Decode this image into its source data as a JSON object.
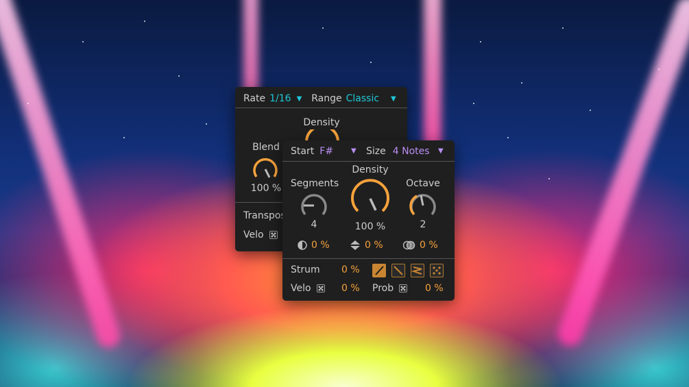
{
  "back_panel": {
    "rate_label": "Rate",
    "rate_value": "1/16",
    "range_label": "Range",
    "range_value": "Classic",
    "density_label": "Density",
    "blend_label": "Blend",
    "blend_value": "100 %",
    "blend_level": 1.0,
    "transpose_label": "Transpos",
    "velo_label": "Velo"
  },
  "front_panel": {
    "start_label": "Start",
    "start_value": "F#",
    "size_label": "Size",
    "size_value": "4 Notes",
    "segments_label": "Segments",
    "segments_value": "4",
    "density_label": "Density",
    "density_value": "100 %",
    "density_level": 1.0,
    "octave_label": "Octave",
    "octave_value": "2",
    "mod1_value": "0 %",
    "mod2_value": "0 %",
    "mod3_value": "0 %",
    "strum_label": "Strum",
    "strum_value": "0 %",
    "velo_label": "Velo",
    "velo_value": "0 %",
    "prob_label": "Prob",
    "prob_value": "0 %"
  },
  "colors": {
    "accent_orange": "#f6a23c",
    "accent_cyan": "#1fc8d8",
    "accent_violet": "#b98ff2",
    "panel_bg": "#1f1f1f"
  },
  "icons": {
    "dropdown": "triangle-down-icon",
    "dice": "dice-icon",
    "mod1": "half-circle-icon",
    "mod2": "up-down-arrows-icon",
    "mod3": "overlap-circles-icon"
  }
}
